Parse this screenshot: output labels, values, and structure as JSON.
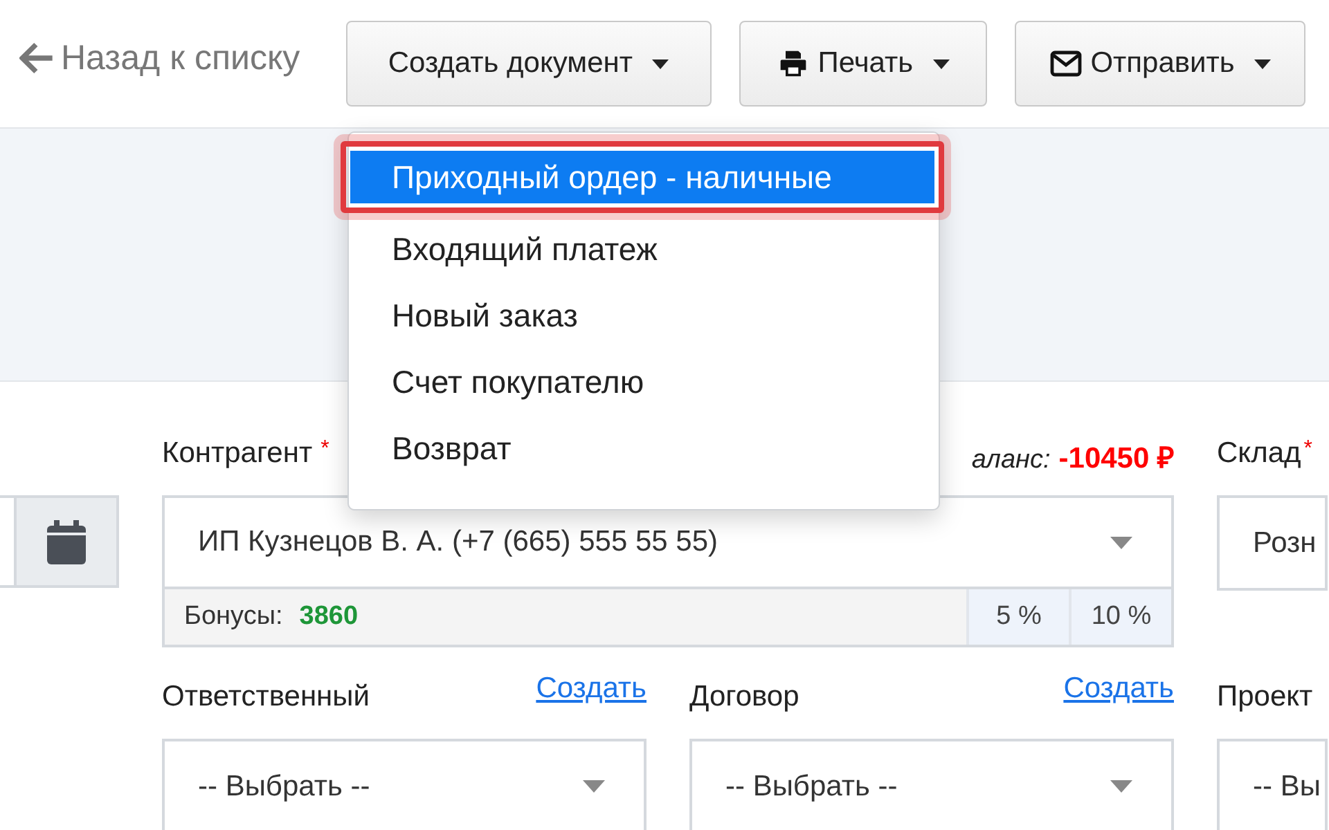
{
  "back_link": {
    "label": "Назад к списку"
  },
  "toolbar": [
    {
      "kind": "create",
      "label": "Создать документ",
      "menu_items": [
        {
          "label": "Приходный ордер - наличные",
          "selected": true
        },
        {
          "label": "Входящий платеж",
          "selected": false
        },
        {
          "label": "Новый заказ",
          "selected": false
        },
        {
          "label": "Счет покупателю",
          "selected": false
        },
        {
          "label": "Возврат",
          "selected": false
        }
      ]
    },
    {
      "kind": "print",
      "label": "Печать"
    },
    {
      "kind": "send",
      "label": "Отправить"
    }
  ],
  "fields": [
    {
      "kind": "client",
      "label": "Контрагент",
      "required_mark": "*",
      "value": "ИП Кузнецов В. А. (+7 (665) 555 55 55)",
      "balance_label": "аланс:",
      "balance": "-10450 ₽",
      "bonuses_label": "Бонусы:",
      "bonuses": "3860",
      "discounts": [
        "5 %",
        "10 %"
      ]
    },
    {
      "kind": "text",
      "label": "Склад",
      "required_mark": "*",
      "value": "Розн"
    },
    {
      "kind": "select",
      "label": "Ответственный",
      "link": "Создать",
      "value": "-- Выбрать --"
    },
    {
      "kind": "select",
      "label": "Договор",
      "link": "Создать",
      "value": "-- Выбрать --"
    },
    {
      "kind": "select",
      "label": "Проект",
      "value": "-- Вы"
    }
  ]
}
